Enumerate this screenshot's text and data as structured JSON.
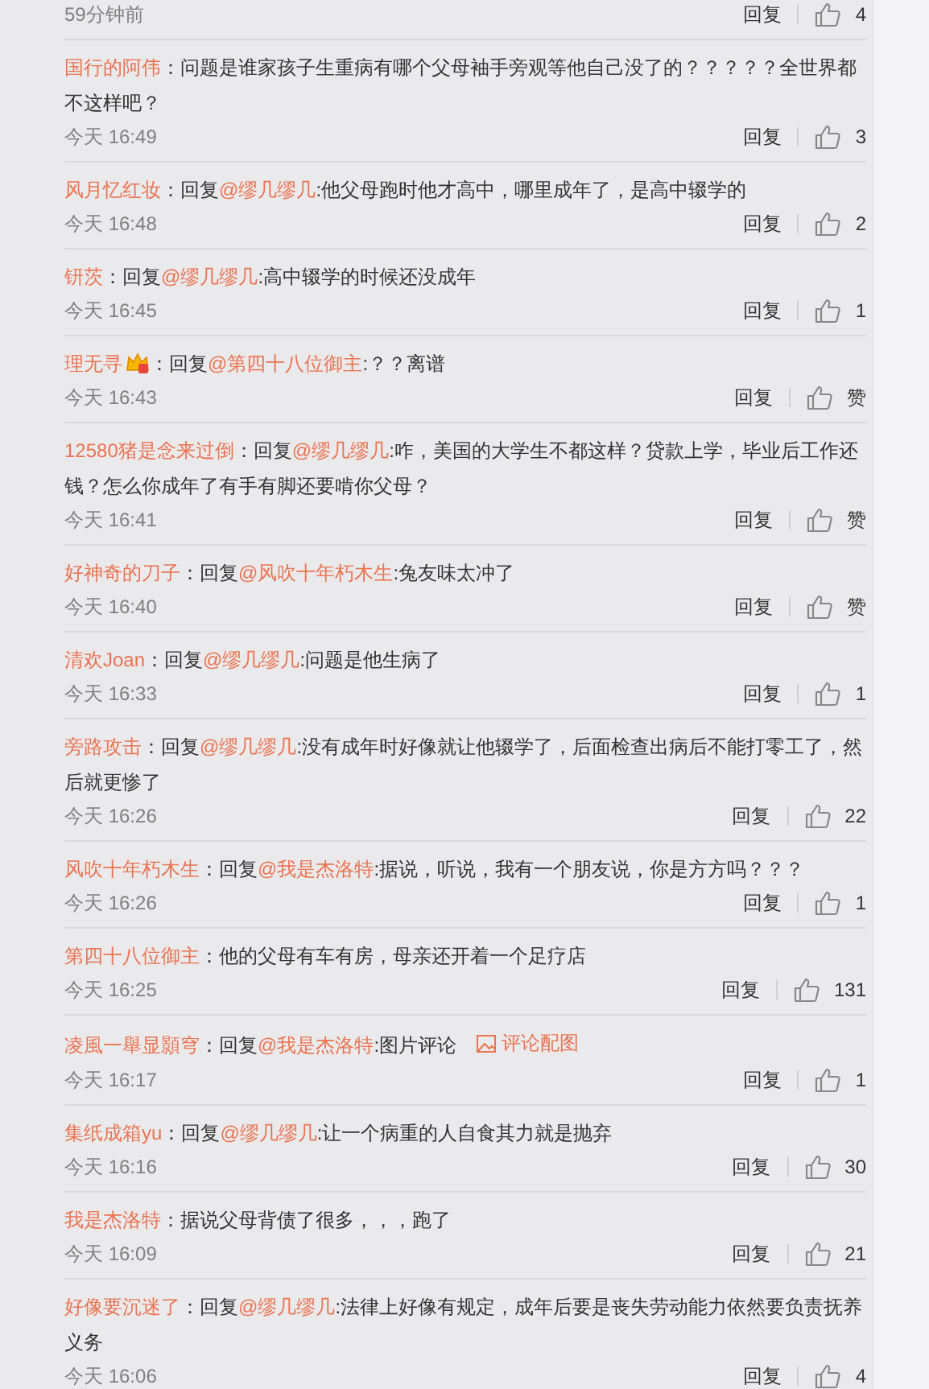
{
  "comments": [
    {
      "time": "59分钟前",
      "reply_label": "回复",
      "likes": "4"
    },
    {
      "name": "国行的阿伟",
      "segments": [
        {
          "kind": "text",
          "text": "：问题是谁家孩子生重病有哪个父母袖手旁观等他自己没了的？？？？？全世界都不这样吧？"
        }
      ],
      "time": "今天 16:49",
      "reply_label": "回复",
      "likes": "3"
    },
    {
      "name": "风月忆红妆",
      "segments": [
        {
          "kind": "text",
          "text": "：回复"
        },
        {
          "kind": "mention",
          "text": "@缪几缪几"
        },
        {
          "kind": "text",
          "text": ":他父母跑时他才高中，哪里成年了，是高中辍学的"
        }
      ],
      "time": "今天 16:48",
      "reply_label": "回复",
      "likes": "2"
    },
    {
      "name": "钘茨",
      "segments": [
        {
          "kind": "text",
          "text": "：回复"
        },
        {
          "kind": "mention",
          "text": "@缪几缪几"
        },
        {
          "kind": "text",
          "text": ":高中辍学的时候还没成年"
        }
      ],
      "time": "今天 16:45",
      "reply_label": "回复",
      "likes": "1"
    },
    {
      "name": "理无寻",
      "badge": true,
      "segments": [
        {
          "kind": "text",
          "text": "：回复"
        },
        {
          "kind": "mention",
          "text": "@第四十八位御主"
        },
        {
          "kind": "text",
          "text": ":？？离谱"
        }
      ],
      "time": "今天 16:43",
      "reply_label": "回复",
      "likes": "赞"
    },
    {
      "name": "12580猪是念来过倒",
      "segments": [
        {
          "kind": "text",
          "text": "：回复"
        },
        {
          "kind": "mention",
          "text": "@缪几缪几"
        },
        {
          "kind": "text",
          "text": ":咋，美国的大学生不都这样？贷款上学，毕业后工作还钱？怎么你成年了有手有脚还要啃你父母？"
        }
      ],
      "time": "今天 16:41",
      "reply_label": "回复",
      "likes": "赞"
    },
    {
      "name": "好神奇的刀子",
      "segments": [
        {
          "kind": "text",
          "text": "：回复"
        },
        {
          "kind": "mention",
          "text": "@风吹十年朽木生"
        },
        {
          "kind": "text",
          "text": ":兔友味太冲了"
        }
      ],
      "time": "今天 16:40",
      "reply_label": "回复",
      "likes": "赞"
    },
    {
      "name": "清欢Joan",
      "segments": [
        {
          "kind": "text",
          "text": "：回复"
        },
        {
          "kind": "mention",
          "text": "@缪几缪几"
        },
        {
          "kind": "text",
          "text": ":问题是他生病了"
        }
      ],
      "time": "今天 16:33",
      "reply_label": "回复",
      "likes": "1"
    },
    {
      "name": "旁路攻击",
      "segments": [
        {
          "kind": "text",
          "text": "：回复"
        },
        {
          "kind": "mention",
          "text": "@缪几缪几"
        },
        {
          "kind": "text",
          "text": ":没有成年时好像就让他辍学了，后面检查出病后不能打零工了，然后就更惨了"
        }
      ],
      "time": "今天 16:26",
      "reply_label": "回复",
      "likes": "22"
    },
    {
      "name": "风吹十年朽木生",
      "segments": [
        {
          "kind": "text",
          "text": "：回复"
        },
        {
          "kind": "mention",
          "text": "@我是杰洛特"
        },
        {
          "kind": "text",
          "text": ":据说，听说，我有一个朋友说，你是方方吗？？？"
        }
      ],
      "time": "今天 16:26",
      "reply_label": "回复",
      "likes": "1"
    },
    {
      "name": "第四十八位御主",
      "segments": [
        {
          "kind": "text",
          "text": "：他的父母有车有房，母亲还开着一个足疗店"
        }
      ],
      "time": "今天 16:25",
      "reply_label": "回复",
      "likes": "131"
    },
    {
      "name": "凌風一舉显顥穹",
      "segments": [
        {
          "kind": "text",
          "text": "：回复"
        },
        {
          "kind": "mention",
          "text": "@我是杰洛特"
        },
        {
          "kind": "text",
          "text": ":图片评论"
        }
      ],
      "image_link": "评论配图",
      "time": "今天 16:17",
      "reply_label": "回复",
      "likes": "1"
    },
    {
      "name": "集纸成箱yu",
      "segments": [
        {
          "kind": "text",
          "text": "：回复"
        },
        {
          "kind": "mention",
          "text": "@缪几缪几"
        },
        {
          "kind": "text",
          "text": ":让一个病重的人自食其力就是抛弃"
        }
      ],
      "time": "今天 16:16",
      "reply_label": "回复",
      "likes": "30"
    },
    {
      "name": "我是杰洛特",
      "segments": [
        {
          "kind": "text",
          "text": "：据说父母背债了很多，，，跑了"
        }
      ],
      "time": "今天 16:09",
      "reply_label": "回复",
      "likes": "21"
    },
    {
      "name": "好像要沉迷了",
      "segments": [
        {
          "kind": "text",
          "text": "：回复"
        },
        {
          "kind": "mention",
          "text": "@缪几缪几"
        },
        {
          "kind": "text",
          "text": ":法律上好像有规定，成年后要是丧失劳动能力依然要负责抚养义务"
        }
      ],
      "time": "今天 16:06",
      "reply_label": "回复",
      "likes": "4"
    }
  ]
}
